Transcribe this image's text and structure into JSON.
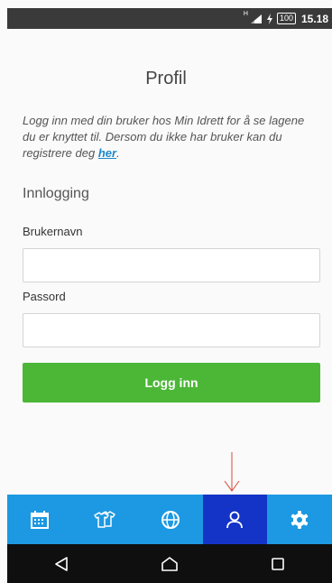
{
  "status_bar": {
    "network_label": "H",
    "battery": "100",
    "time": "15.18",
    "icons": [
      "signal-icon",
      "charging-icon",
      "battery-icon"
    ]
  },
  "page": {
    "title": "Profil",
    "intro_text": "Logg inn med din bruker hos Min Idrett for å se lagene du er knyttet til. Dersom du ikke har bruker kan du registrere deg ",
    "register_link": "her",
    "intro_end": "."
  },
  "login_form": {
    "section_title": "Innlogging",
    "username_label": "Brukernavn",
    "username_value": "",
    "password_label": "Passord",
    "password_value": "",
    "submit_label": "Logg inn"
  },
  "bottom_nav": {
    "items": [
      {
        "name": "calendar",
        "icon": "calendar-icon",
        "active": false
      },
      {
        "name": "teams",
        "icon": "shirts-icon",
        "active": false
      },
      {
        "name": "web",
        "icon": "globe-icon",
        "active": false
      },
      {
        "name": "profile",
        "icon": "person-icon",
        "active": true
      },
      {
        "name": "settings",
        "icon": "gear-icon",
        "active": false
      }
    ]
  },
  "system_nav": {
    "icons": [
      "back-icon",
      "home-icon",
      "recents-icon"
    ]
  },
  "colors": {
    "primary_blue": "#1d98e2",
    "active_nav": "#1434c8",
    "login_green": "#4cb637",
    "link_blue": "#1e88c8",
    "annotation_red": "#d9483b"
  }
}
